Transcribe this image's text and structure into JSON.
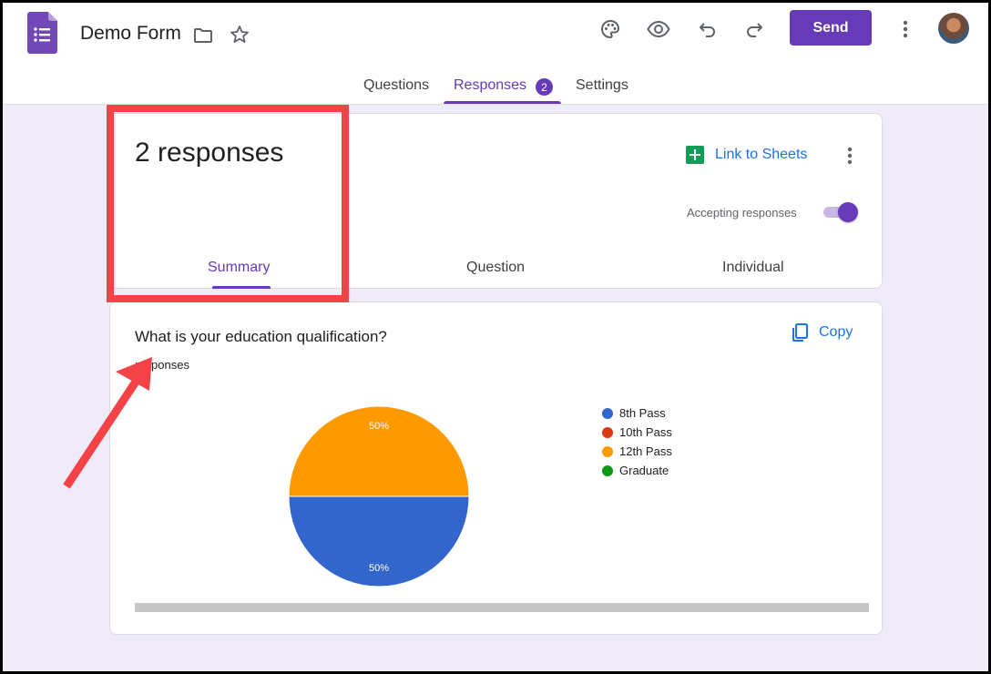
{
  "header": {
    "title": "Demo Form",
    "send_label": "Send"
  },
  "tabs": [
    {
      "label": "Questions"
    },
    {
      "label": "Responses",
      "badge": "2"
    },
    {
      "label": "Settings"
    }
  ],
  "summary_card": {
    "count_text": "2 responses",
    "link_sheets_label": "Link to Sheets",
    "accepting_label": "Accepting responses",
    "accepting_on": true,
    "subtabs": [
      "Summary",
      "Question",
      "Individual"
    ]
  },
  "question_card": {
    "question": "What is your education qualification?",
    "copy_label": "Copy",
    "responses_label": "responses"
  },
  "chart_data": {
    "type": "pie",
    "categories": [
      "8th Pass",
      "10th Pass",
      "12th Pass",
      "Graduate"
    ],
    "values": [
      50,
      0,
      50,
      0
    ],
    "colors": [
      "#3366cc",
      "#dc3912",
      "#ff9900",
      "#109618"
    ],
    "slice_labels": [
      "50%",
      "",
      "50%",
      ""
    ],
    "legend_position": "right"
  },
  "colors": {
    "accent": "#673ab7",
    "link": "#1a73e8",
    "highlight": "#f44347"
  }
}
